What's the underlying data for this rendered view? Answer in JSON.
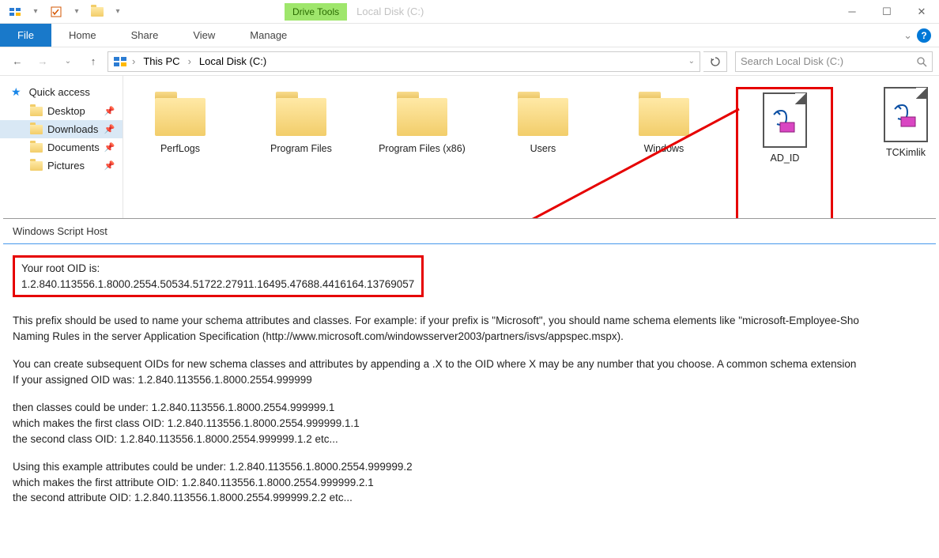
{
  "titlebar": {
    "drive_tools": "Drive Tools",
    "title": "Local Disk (C:)"
  },
  "ribbon": {
    "file": "File",
    "home": "Home",
    "share": "Share",
    "view": "View",
    "manage": "Manage"
  },
  "breadcrumb": {
    "seg1": "This PC",
    "seg2": "Local Disk (C:)"
  },
  "search": {
    "placeholder": "Search Local Disk (C:)"
  },
  "sidebar": {
    "items": [
      {
        "label": "Quick access"
      },
      {
        "label": "Desktop"
      },
      {
        "label": "Downloads"
      },
      {
        "label": "Documents"
      },
      {
        "label": "Pictures"
      }
    ]
  },
  "folders": {
    "perflogs": "PerfLogs",
    "program_files": "Program Files",
    "program_files_x86": "Program Files (x86)",
    "users": "Users",
    "windows": "Windows",
    "ad_id": "AD_ID",
    "tckimlik": "TCKimlik"
  },
  "dialog": {
    "title": "Windows Script Host",
    "oid_label": "Your root OID is:",
    "oid_value": "1.2.840.113556.1.8000.2554.50534.51722.27911.16495.47688.4416164.13769057",
    "p1a": "This prefix should be used to name your schema attributes and classes. For example: if your prefix is \"Microsoft\", you should name schema elements like \"microsoft-Employee-Sho",
    "p1b": "Naming Rules in the server Application Specification (http://www.microsoft.com/windowsserver2003/partners/isvs/appspec.mspx).",
    "p2a": "You can create subsequent OIDs for new schema classes and attributes by appending a .X to the OID where X may be any number that you choose.  A common schema extension",
    "p2b": "If your assigned OID was: 1.2.840.113556.1.8000.2554.999999",
    "p3a": "then classes could be under: 1.2.840.113556.1.8000.2554.999999.1",
    "p3b": "which makes the first class OID: 1.2.840.113556.1.8000.2554.999999.1.1",
    "p3c": "the second class OID: 1.2.840.113556.1.8000.2554.999999.1.2     etc...",
    "p4a": "Using this example attributes could be under: 1.2.840.113556.1.8000.2554.999999.2",
    "p4b": "which makes the first attribute OID: 1.2.840.113556.1.8000.2554.999999.2.1",
    "p4c": "the second attribute OID: 1.2.840.113556.1.8000.2554.999999.2.2     etc..."
  }
}
